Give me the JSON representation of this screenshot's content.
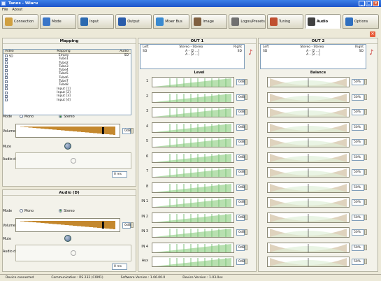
{
  "window": {
    "title": "Tanos - Wiaru"
  },
  "menu": [
    "File",
    "About"
  ],
  "tabs": [
    {
      "label": "Connection",
      "icon": "connection-icon",
      "color": "#d0a040"
    },
    {
      "label": "Mode",
      "icon": "mode-icon",
      "color": "#3a76c8"
    },
    {
      "label": "Input",
      "icon": "input-icon",
      "color": "#2c6ab0"
    },
    {
      "label": "Output",
      "icon": "output-icon",
      "color": "#2a5caa"
    },
    {
      "label": "Mixer Bus",
      "icon": "mixer-icon",
      "color": "#3a8ad0"
    },
    {
      "label": "Image",
      "icon": "image-icon",
      "color": "#806040"
    },
    {
      "label": "Logos/Presets",
      "icon": "logos-icon",
      "color": "#707070"
    },
    {
      "label": "Tuning",
      "icon": "tuning-icon",
      "color": "#c05030"
    },
    {
      "label": "Audio",
      "icon": "audio-icon",
      "color": "#404040",
      "active": true
    },
    {
      "label": "Options",
      "icon": "options-icon",
      "color": "#3070c0"
    }
  ],
  "mapping": {
    "title": "Mapping",
    "headers": [
      "Video",
      "Mapping",
      "Audio"
    ],
    "rows": [
      {
        "video": "SD",
        "map": "Empty",
        "audio": "SD"
      },
      {
        "video": "",
        "map": "Tube1",
        "audio": ""
      },
      {
        "video": "",
        "map": "Tube2",
        "audio": ""
      },
      {
        "video": "",
        "map": "Tube3",
        "audio": ""
      },
      {
        "video": "",
        "map": "Tube4",
        "audio": ""
      },
      {
        "video": "",
        "map": "Tube5",
        "audio": ""
      },
      {
        "video": "",
        "map": "Tube6",
        "audio": ""
      },
      {
        "video": "",
        "map": "Tube7",
        "audio": ""
      },
      {
        "video": "",
        "map": "Tube8",
        "audio": ""
      },
      {
        "video": "",
        "map": "Input [1]",
        "audio": ""
      },
      {
        "video": "",
        "map": "Input [2]",
        "audio": ""
      },
      {
        "video": "",
        "map": "Input [3]",
        "audio": ""
      },
      {
        "video": "",
        "map": "Input [4]",
        "audio": ""
      }
    ],
    "mode_label": "Mode",
    "mono": "Mono",
    "stereo": "Stereo",
    "volume_label": "Volume",
    "volume_value": "0dB",
    "mute_label": "Mute",
    "delay_label": "Audio delay",
    "delay_value": "0 ms"
  },
  "audio_in": {
    "title": "Audio (D)",
    "mode_label": "Mode",
    "mono": "Mono",
    "stereo": "Stereo",
    "volume_label": "Volume",
    "volume_value": "0dB",
    "mute_label": "Mute",
    "delay_label": "Audio delay",
    "delay_value": "0 ms"
  },
  "out1": {
    "title": "OUT 1",
    "left": "Left",
    "routing": "Stereo - Stereo",
    "right": "Right",
    "lv": "SD",
    "mid1": "A - [2 ...]",
    "mid2": "A - [2 ...]",
    "rv": "SD"
  },
  "out2": {
    "title": "OUT 2",
    "left": "Left",
    "routing": "Stereo - Stereo",
    "right": "Right",
    "lv": "SD",
    "mid1": "A - [2 ...]",
    "mid2": "A - [2 ...]",
    "rv": "SD"
  },
  "level_title": "Level",
  "balance_title": "Balance",
  "channels": [
    {
      "name": "1",
      "level": "0dB",
      "balance": "50%"
    },
    {
      "name": "2",
      "level": "0dB",
      "balance": "50%"
    },
    {
      "name": "3",
      "level": "0dB",
      "balance": "50%"
    },
    {
      "name": "4",
      "level": "0dB",
      "balance": "50%"
    },
    {
      "name": "5",
      "level": "0dB",
      "balance": "50%"
    },
    {
      "name": "6",
      "level": "0dB",
      "balance": "50%"
    },
    {
      "name": "7",
      "level": "0dB",
      "balance": "50%"
    },
    {
      "name": "8",
      "level": "0dB",
      "balance": "50%"
    },
    {
      "name": "IN 1",
      "level": "0dB",
      "balance": "50%"
    },
    {
      "name": "IN 2",
      "level": "0dB",
      "balance": "50%"
    },
    {
      "name": "IN 3",
      "level": "0dB",
      "balance": "50%"
    },
    {
      "name": "IN 4",
      "level": "0dB",
      "balance": "50%"
    }
  ],
  "aux": {
    "name": "Aux",
    "level": "0dB",
    "balance": "50%"
  },
  "status": {
    "connection": "Device connected",
    "comm": "Communication : RS 232 (COM1)",
    "software": "Software Version : 1.06.00.0",
    "device": "Device Version : 1.03.0xx"
  },
  "colors": {
    "level_fill": "#b8e0b0",
    "level_bar": "#7cc27a",
    "balance_fill": "#c9b592",
    "volume_fill": "#c4882e"
  }
}
